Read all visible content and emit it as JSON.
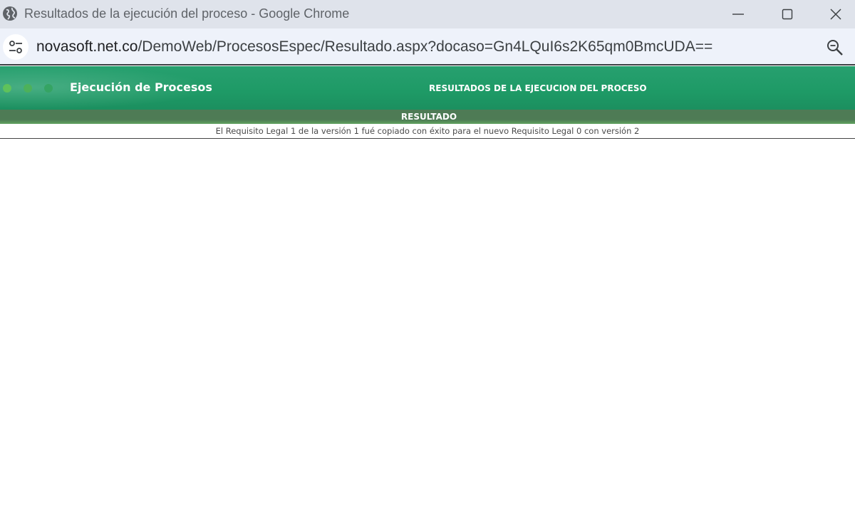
{
  "window": {
    "title": "Resultados de la ejecución del proceso - Google Chrome"
  },
  "address_bar": {
    "url_host": "novasoft.net.co",
    "url_path": "/DemoWeb/ProcesosEspec/Resultado.aspx?docaso=Gn4LQuI6s2K65qm0BmcUDA=="
  },
  "app_header": {
    "title": "Ejecución de Procesos",
    "heading": "RESULTADOS DE LA EJECUCION DEL PROCESO"
  },
  "result": {
    "label": "RESULTADO",
    "message": "El Requisito Legal 1 de la versión 1 fué copiado con éxito para el nuevo Requisito Legal 0 con versión 2"
  },
  "colors": {
    "titlebar_bg": "#dfe3eb",
    "addressbar_bg": "#eef2fa",
    "header_green": "#1e9a66",
    "result_bar_green": "#4e7b55"
  },
  "icons": [
    "globe-icon",
    "minimize-icon",
    "maximize-icon",
    "close-icon",
    "site-info-icon",
    "zoom-icon"
  ]
}
